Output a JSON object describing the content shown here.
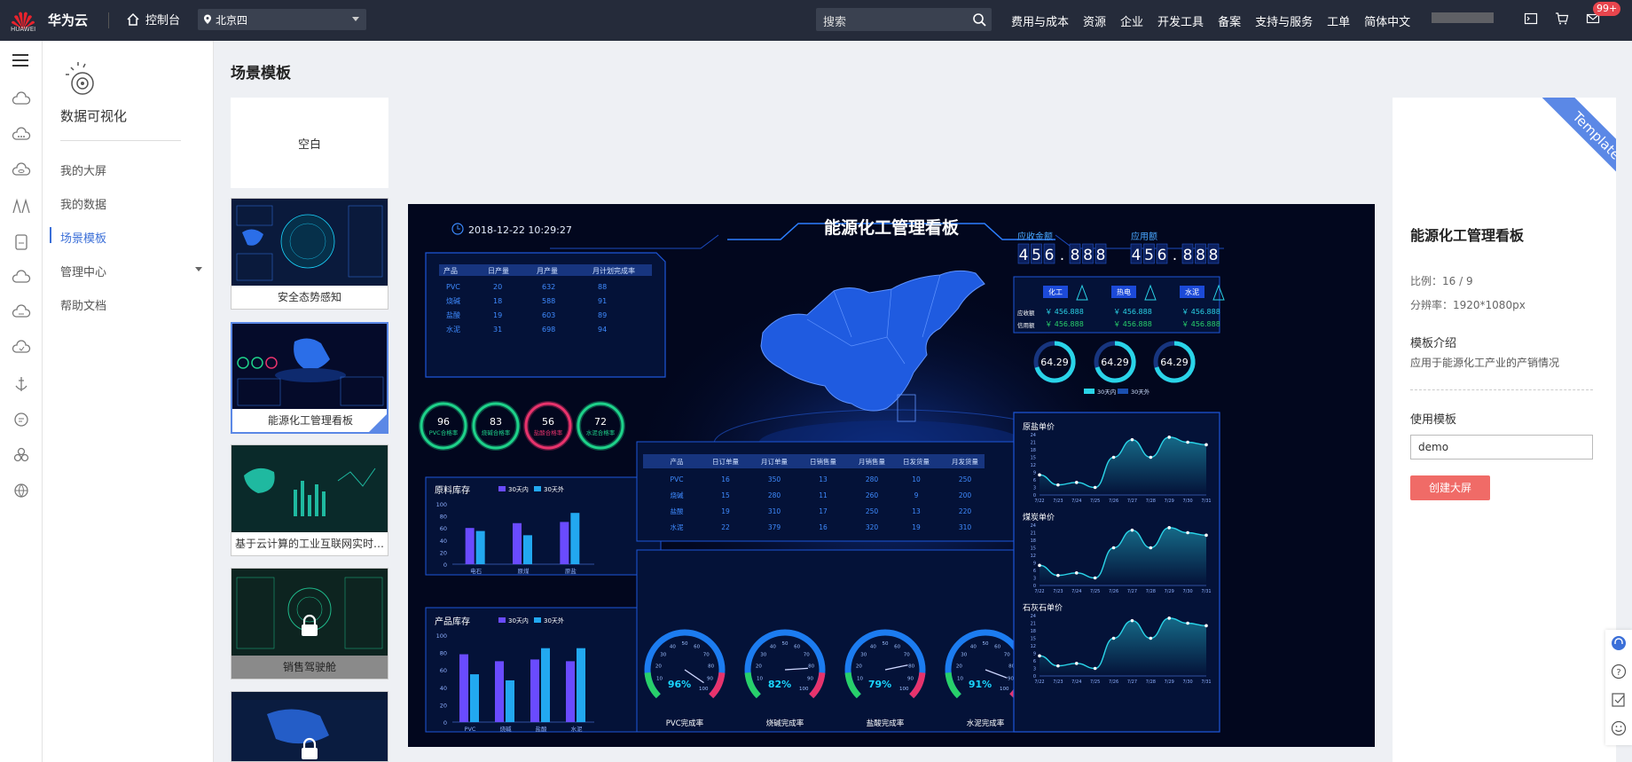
{
  "topbar": {
    "brand": "华为云",
    "logo_word": "HUAWEI",
    "console": "控制台",
    "region": "北京四",
    "search_placeholder": "搜索",
    "nav": [
      "费用与成本",
      "资源",
      "企业",
      "开发工具",
      "备案",
      "支持与服务",
      "工单",
      "简体中文"
    ],
    "badge": "99+"
  },
  "sidenav": {
    "title": "数据可视化",
    "items": [
      "我的大屏",
      "我的数据",
      "场景模板",
      "管理中心",
      "帮助文档"
    ],
    "active": "场景模板"
  },
  "page": {
    "title": "场景模板"
  },
  "templates": {
    "blank": "空白",
    "cards": [
      "安全态势感知",
      "能源化工管理看板",
      "基于云计算的工业互联网实时…",
      "销售驾驶舱"
    ]
  },
  "dashboard": {
    "datetime": "2018-12-22 10:29:27",
    "title": "能源化工管理看板",
    "receivable_label": "应收金额",
    "paid_label": "应用额",
    "digits_a": [
      "4",
      "5",
      "6",
      ".",
      "8",
      "8",
      "8"
    ],
    "digits_b": [
      "4",
      "5",
      "6",
      ".",
      "8",
      "8",
      "8"
    ],
    "cats": [
      "化工",
      "热电",
      "水泥"
    ],
    "row_labels": [
      "应收额",
      "信用额"
    ],
    "money": "￥ 456.888",
    "ring_value": "64.29",
    "ring_legend": [
      "30天内",
      "30天外"
    ],
    "top_table": {
      "headers": [
        "产品",
        "日产量",
        "月产量",
        "月计划完成率"
      ],
      "rows": [
        [
          "PVC",
          "20",
          "632",
          "88"
        ],
        [
          "烧碱",
          "18",
          "588",
          "91"
        ],
        [
          "盐酸",
          "19",
          "603",
          "89"
        ],
        [
          "水泥",
          "31",
          "698",
          "94"
        ]
      ]
    },
    "circles": [
      {
        "value": "96",
        "label": "PVC合格率",
        "color": "#1ed28a"
      },
      {
        "value": "83",
        "label": "烧碱合格率",
        "color": "#1ed28a"
      },
      {
        "value": "56",
        "label": "盐酸合格率",
        "color": "#e8336c"
      },
      {
        "value": "72",
        "label": "水泥合格率",
        "color": "#1ed28a"
      }
    ],
    "raw_stock": {
      "title": "原料库存",
      "legend": [
        "30天内",
        "30天外"
      ],
      "categories": [
        "电石",
        "原煤",
        "原盐"
      ],
      "in30": [
        60,
        68,
        70
      ],
      "out30": [
        55,
        48,
        85
      ],
      "yticks": [
        "100",
        "80",
        "60",
        "40",
        "20",
        "0"
      ]
    },
    "product_stock": {
      "title": "产品库存",
      "legend": [
        "30天内",
        "30天外"
      ],
      "categories": [
        "PVC",
        "烧碱",
        "盐酸",
        "水泥"
      ],
      "in30": [
        78,
        70,
        72,
        70
      ],
      "out30": [
        55,
        48,
        85,
        85
      ],
      "yticks": [
        "100",
        "80",
        "60",
        "40",
        "20",
        "0"
      ]
    },
    "mid_table": {
      "headers": [
        "产品",
        "日订单量",
        "月订单量",
        "日销售量",
        "月销售量",
        "日发货量",
        "月发货量"
      ],
      "rows": [
        [
          "PVC",
          "16",
          "350",
          "13",
          "280",
          "10",
          "250"
        ],
        [
          "烧碱",
          "15",
          "280",
          "11",
          "260",
          "9",
          "200"
        ],
        [
          "盐酸",
          "19",
          "310",
          "17",
          "250",
          "13",
          "220"
        ],
        [
          "水泥",
          "22",
          "379",
          "16",
          "320",
          "19",
          "310"
        ]
      ]
    },
    "gauges": [
      {
        "pct": "96%",
        "label": "PVC完成率",
        "value": 96
      },
      {
        "pct": "82%",
        "label": "烧碱完成率",
        "value": 82
      },
      {
        "pct": "79%",
        "label": "盐酸完成率",
        "value": 79
      },
      {
        "pct": "91%",
        "label": "水泥完成率",
        "value": 91
      }
    ],
    "gauge_ticks": [
      "10",
      "20",
      "30",
      "40",
      "50",
      "60",
      "70",
      "80",
      "90",
      "100"
    ],
    "prices": [
      {
        "title": "原盐单价",
        "values": [
          8,
          4,
          5,
          3,
          15,
          22,
          15,
          23,
          21,
          20
        ]
      },
      {
        "title": "煤炭单价",
        "values": [
          8,
          4,
          5,
          3,
          15,
          22,
          15,
          23,
          21,
          20
        ]
      },
      {
        "title": "石灰石单价",
        "values": [
          8,
          4,
          5,
          3,
          15,
          22,
          15,
          23,
          21,
          20
        ]
      }
    ],
    "price_dates": [
      "7/22",
      "7/23",
      "7/24",
      "7/25",
      "7/26",
      "7/27",
      "7/28",
      "7/29",
      "7/30",
      "7/31"
    ],
    "price_yticks": [
      "24",
      "21",
      "18",
      "15",
      "12",
      "9",
      "6",
      "3",
      "0"
    ]
  },
  "info": {
    "ribbon": "Template",
    "title": "能源化工管理看板",
    "ratio": "比例：16 / 9",
    "resolution": "分辨率：1920*1080px",
    "intro_title": "模板介绍",
    "intro": "应用于能源化工产业的产销情况",
    "use_title": "使用模板",
    "input_value": "demo",
    "create_button": "创建大屏"
  }
}
